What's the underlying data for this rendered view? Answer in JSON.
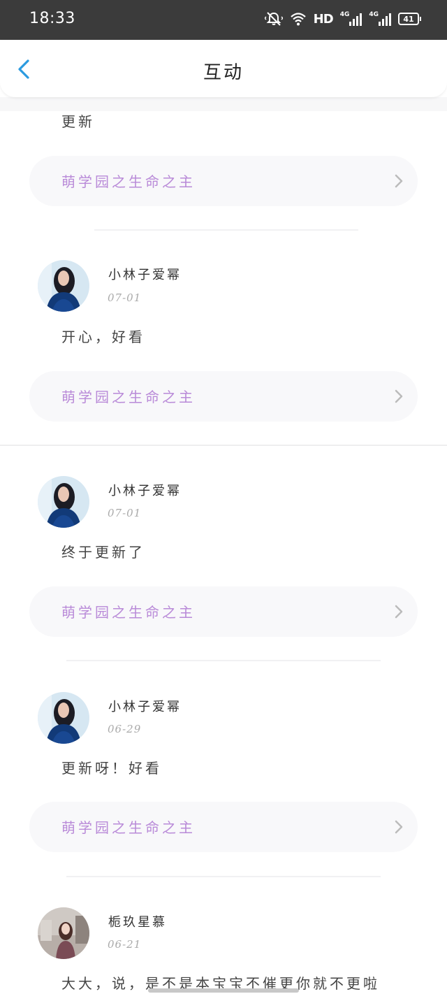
{
  "status_bar": {
    "time": "18:33",
    "hd_label": "HD",
    "network_1": "4G",
    "network_2": "4G",
    "battery": "41"
  },
  "header": {
    "title": "互动"
  },
  "feed": {
    "partial": {
      "text": "更新",
      "book": "萌学园之生命之主"
    },
    "items": [
      {
        "user": "小林子爱幂",
        "date": "07-01",
        "text": "开心，好看",
        "book": "萌学园之生命之主"
      },
      {
        "user": "小林子爱幂",
        "date": "07-01",
        "text": "终于更新了",
        "book": "萌学园之生命之主"
      },
      {
        "user": "小林子爱幂",
        "date": "06-29",
        "text": "更新呀！好看",
        "book": "萌学园之生命之主"
      },
      {
        "user": "栀玖星慕",
        "date": "06-21",
        "text": "大大，说，是不是本宝宝不催更你就不更啦"
      }
    ]
  },
  "colors": {
    "accent": "#2b9be0",
    "book_title": "#b98ad8",
    "status_bar_bg": "#3b3b3b"
  }
}
